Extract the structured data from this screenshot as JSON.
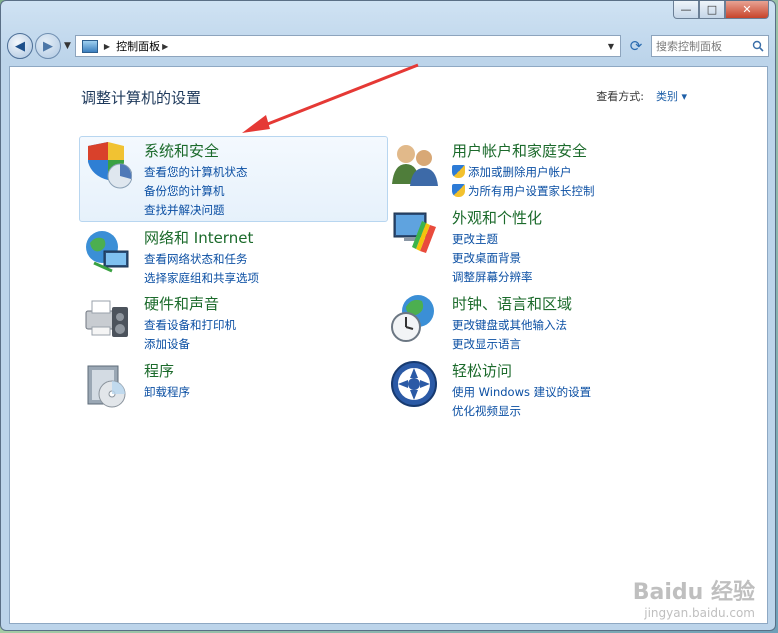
{
  "window": {
    "controls": {
      "minimize": "—",
      "maximize": "□",
      "close": "✕"
    }
  },
  "nav": {
    "address_path": "控制面板",
    "search_placeholder": "搜索控制面板"
  },
  "main": {
    "heading": "调整计算机的设置",
    "view_by_label": "查看方式:",
    "view_by_value": "类别"
  },
  "categories": [
    {
      "title": "系统和安全",
      "icon": "system-security-icon",
      "links": [
        "查看您的计算机状态",
        "备份您的计算机",
        "查找并解决问题"
      ]
    },
    {
      "title": "网络和 Internet",
      "icon": "network-icon",
      "links": [
        "查看网络状态和任务",
        "选择家庭组和共享选项"
      ]
    },
    {
      "title": "硬件和声音",
      "icon": "hardware-sound-icon",
      "links": [
        "查看设备和打印机",
        "添加设备"
      ]
    },
    {
      "title": "程序",
      "icon": "programs-icon",
      "links": [
        "卸载程序"
      ]
    },
    {
      "title": "用户帐户和家庭安全",
      "icon": "user-accounts-icon",
      "links": [
        "添加或删除用户帐户",
        "为所有用户设置家长控制"
      ]
    },
    {
      "title": "外观和个性化",
      "icon": "appearance-icon",
      "links": [
        "更改主题",
        "更改桌面背景",
        "调整屏幕分辨率"
      ]
    },
    {
      "title": "时钟、语言和区域",
      "icon": "clock-language-icon",
      "links": [
        "更改键盘或其他输入法",
        "更改显示语言"
      ]
    },
    {
      "title": "轻松访问",
      "icon": "ease-of-access-icon",
      "links": [
        "使用 Windows 建议的设置",
        "优化视频显示"
      ]
    }
  ],
  "watermark": {
    "main": "Baidu 经验",
    "sub": "jingyan.baidu.com"
  },
  "colors": {
    "link": "#0b4fa3",
    "category_title": "#1b6a2b",
    "annotation_arrow": "#e53935"
  }
}
